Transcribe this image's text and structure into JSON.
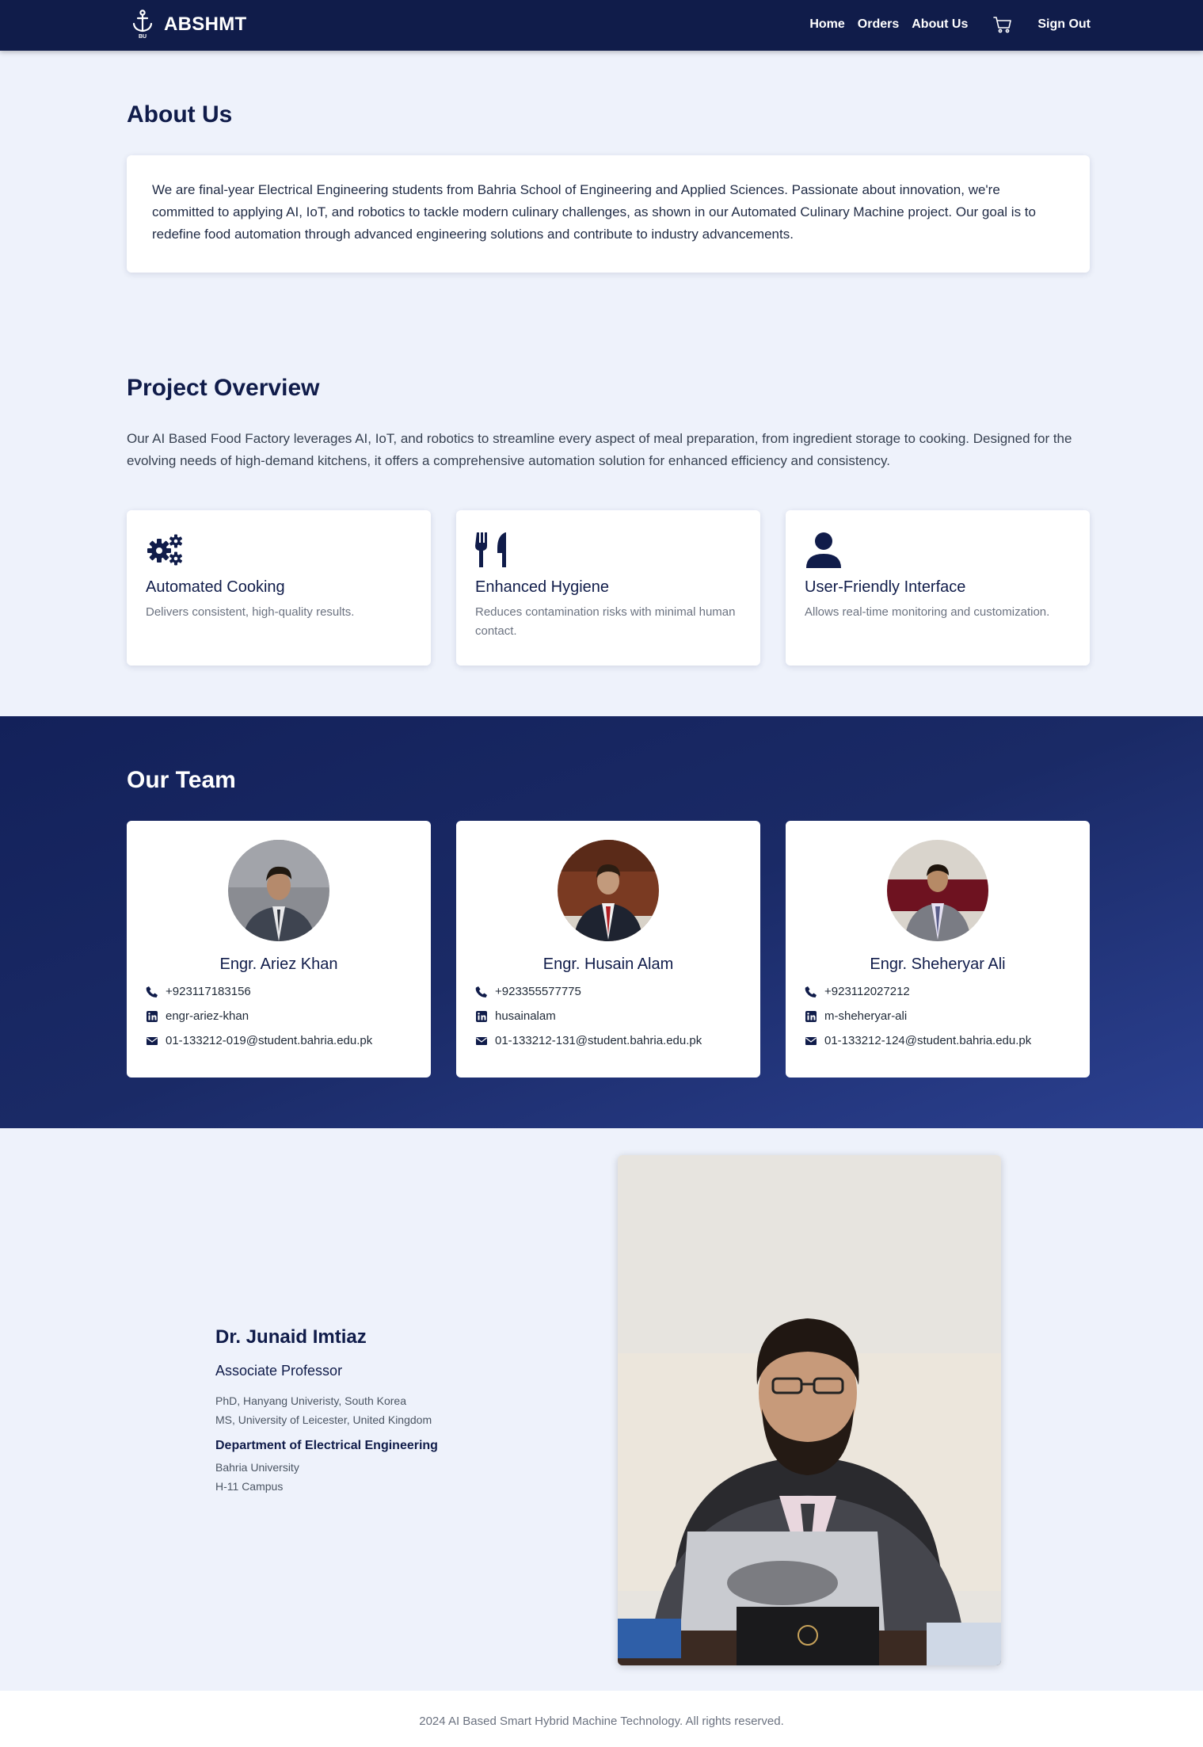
{
  "nav": {
    "brand": "ABSHMT",
    "logo_icon": "anchor-icon",
    "links": [
      "Home",
      "Orders",
      "About Us"
    ],
    "cart_icon": "cart-icon",
    "sign_out": "Sign Out"
  },
  "about": {
    "title": "About Us",
    "text": "We are final-year Electrical Engineering students from Bahria School of Engineering and Applied Sciences. Passionate about innovation, we're committed to applying AI, IoT, and robotics to tackle modern culinary challenges, as shown in our Automated Culinary Machine project. Our goal is to redefine food automation through advanced engineering solutions and contribute to industry advancements."
  },
  "project": {
    "title": "Project Overview",
    "text": "Our AI Based Food Factory leverages AI, IoT, and robotics to streamline every aspect of meal preparation, from ingredient storage to cooking. Designed for the evolving needs of high-demand kitchens, it offers a comprehensive automation solution for enhanced efficiency and consistency.",
    "features": [
      {
        "icon": "gears-icon",
        "title": "Automated Cooking",
        "desc": "Delivers consistent, high-quality results."
      },
      {
        "icon": "utensils-icon",
        "title": "Enhanced Hygiene",
        "desc": "Reduces contamination risks with minimal human contact."
      },
      {
        "icon": "user-icon",
        "title": "User-Friendly Interface",
        "desc": "Allows real-time monitoring and customization."
      }
    ]
  },
  "team": {
    "title": "Our Team",
    "members": [
      {
        "name": "Engr. Ariez Khan",
        "phone": "+923117183156",
        "linkedin": "engr-ariez-khan",
        "email": "01-133212-019@student.bahria.edu.pk"
      },
      {
        "name": "Engr. Husain Alam",
        "phone": "+923355577775",
        "linkedin": "husainalam",
        "email": "01-133212-131@student.bahria.edu.pk"
      },
      {
        "name": "Engr. Sheheryar Ali",
        "phone": "+923112027212",
        "linkedin": "m-sheheryar-ali",
        "email": "01-133212-124@student.bahria.edu.pk"
      }
    ]
  },
  "supervisor": {
    "name": "Dr. Junaid Imtiaz",
    "role": "Associate Professor",
    "degree1": "PhD, Hanyang Univeristy, South Korea",
    "degree2": "MS, University of Leicester, United Kingdom",
    "department": "Department of Electrical Engineering",
    "university": "Bahria University",
    "campus": "H-11 Campus"
  },
  "footer": {
    "text": "2024 AI Based Smart Hybrid Machine Technology. All rights reserved."
  },
  "colors": {
    "navy": "#101c4a",
    "background": "#eef2fb"
  }
}
